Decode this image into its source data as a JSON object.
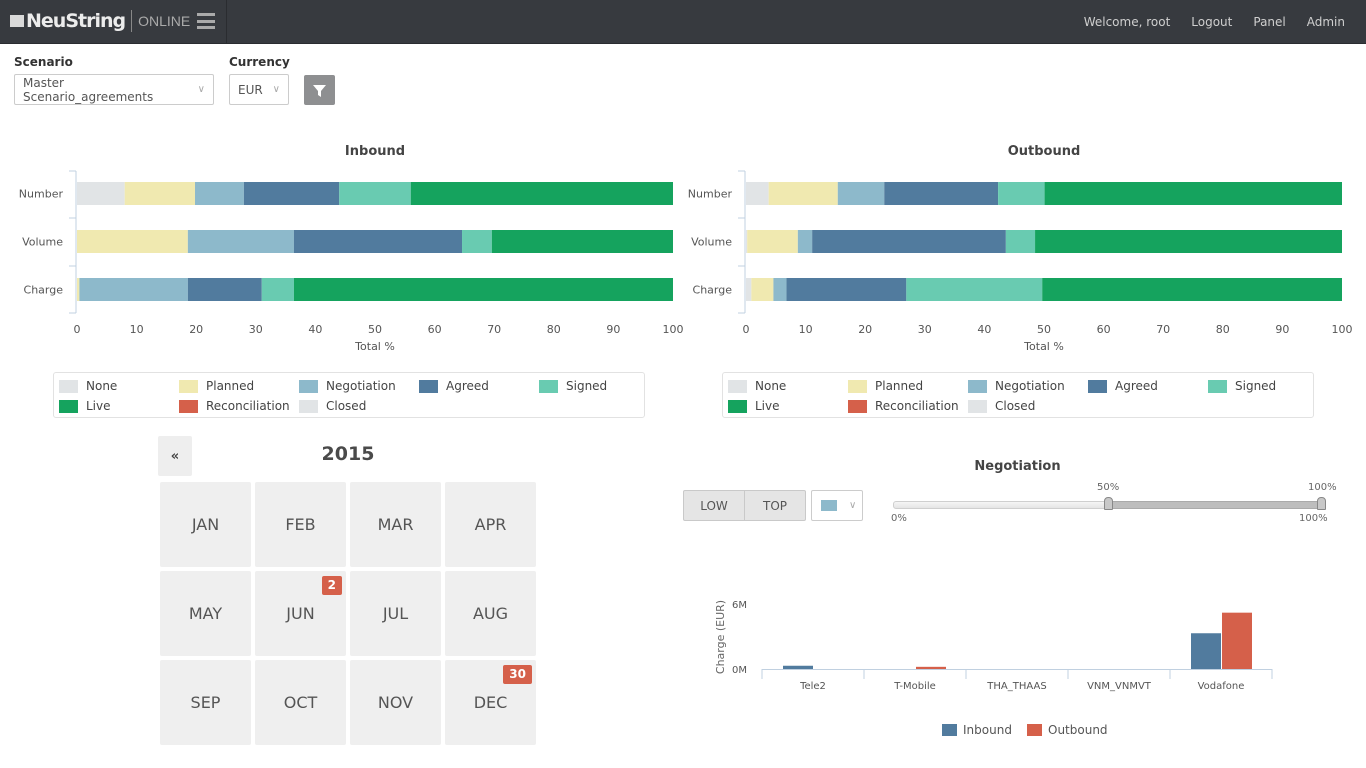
{
  "header": {
    "brand": "NeuString",
    "brand_sub": "ONLINE",
    "welcome": "Welcome, root",
    "nav": [
      "Logout",
      "Panel",
      "Admin"
    ]
  },
  "filters": {
    "scenario_label": "Scenario",
    "scenario_value": "Master Scenario_agreements",
    "currency_label": "Currency",
    "currency_value": "EUR",
    "filter_icon": "filter-icon"
  },
  "status_colors": {
    "None": "#e1e4e6",
    "Planned": "#f0e9b0",
    "Negotiation": "#8db9cb",
    "Agreed": "#517b9e",
    "Signed": "#69cbb1",
    "Live": "#15a35e",
    "Reconciliation": "#d5604a",
    "Closed": "#e1e4e6"
  },
  "legend": [
    "None",
    "Planned",
    "Negotiation",
    "Agreed",
    "Signed",
    "Live",
    "Reconciliation",
    "Closed"
  ],
  "chart_data": [
    {
      "type": "bar",
      "orientation": "horizontal-stacked",
      "title": "Inbound",
      "xlabel": "Total %",
      "ylabel": "",
      "xlim": [
        0,
        100
      ],
      "xticks": [
        0,
        10,
        20,
        30,
        40,
        50,
        60,
        70,
        80,
        90,
        100
      ],
      "categories": [
        "Number",
        "Volume",
        "Charge"
      ],
      "series": [
        {
          "name": "None",
          "values": [
            8,
            0,
            0
          ]
        },
        {
          "name": "Planned",
          "values": [
            11.8,
            18.6,
            0.4
          ]
        },
        {
          "name": "Negotiation",
          "values": [
            8.2,
            17.8,
            18.2
          ]
        },
        {
          "name": "Agreed",
          "values": [
            16,
            28.2,
            12.4
          ]
        },
        {
          "name": "Signed",
          "values": [
            12,
            5,
            5.4
          ]
        },
        {
          "name": "Live",
          "values": [
            44,
            30.4,
            63.6
          ]
        },
        {
          "name": "Reconciliation",
          "values": [
            0,
            0,
            0
          ]
        },
        {
          "name": "Closed",
          "values": [
            0,
            0,
            0
          ]
        }
      ],
      "legend_position": "bottom"
    },
    {
      "type": "bar",
      "orientation": "horizontal-stacked",
      "title": "Outbound",
      "xlabel": "Total %",
      "ylabel": "",
      "xlim": [
        0,
        100
      ],
      "xticks": [
        0,
        10,
        20,
        30,
        40,
        50,
        60,
        70,
        80,
        90,
        100
      ],
      "categories": [
        "Number",
        "Volume",
        "Charge"
      ],
      "series": [
        {
          "name": "None",
          "values": [
            3.8,
            0.2,
            0.9
          ]
        },
        {
          "name": "Planned",
          "values": [
            11.6,
            8.5,
            3.7
          ]
        },
        {
          "name": "Negotiation",
          "values": [
            7.8,
            2.4,
            2.2
          ]
        },
        {
          "name": "Agreed",
          "values": [
            19.1,
            32.5,
            20.1
          ]
        },
        {
          "name": "Signed",
          "values": [
            7.8,
            4.9,
            22.8
          ]
        },
        {
          "name": "Live",
          "values": [
            49.9,
            51.5,
            50.3
          ]
        },
        {
          "name": "Reconciliation",
          "values": [
            0,
            0,
            0
          ]
        },
        {
          "name": "Closed",
          "values": [
            0,
            0,
            0
          ]
        }
      ],
      "legend_position": "bottom"
    },
    {
      "type": "bar",
      "title": "",
      "xlabel": "",
      "ylabel": "Charge (EUR)",
      "ylim": [
        0,
        6
      ],
      "yticks": [
        "0M",
        "6M"
      ],
      "categories": [
        "Tele2",
        "T-Mobile",
        "THA_THAAS",
        "VNM_VNMVT",
        "Vodafone"
      ],
      "series": [
        {
          "name": "Inbound",
          "color": "#517b9e",
          "values": [
            0.3,
            0,
            0,
            0,
            3.3
          ]
        },
        {
          "name": "Outbound",
          "color": "#d5604a",
          "values": [
            0,
            0.2,
            0,
            0,
            5.2
          ]
        }
      ],
      "legend_position": "bottom"
    }
  ],
  "calendar": {
    "prev_label": "«",
    "year": "2015",
    "months": [
      {
        "label": "JAN",
        "badge": null
      },
      {
        "label": "FEB",
        "badge": null
      },
      {
        "label": "MAR",
        "badge": null
      },
      {
        "label": "APR",
        "badge": null
      },
      {
        "label": "MAY",
        "badge": null
      },
      {
        "label": "JUN",
        "badge": "2"
      },
      {
        "label": "JUL",
        "badge": null
      },
      {
        "label": "AUG",
        "badge": null
      },
      {
        "label": "SEP",
        "badge": null
      },
      {
        "label": "OCT",
        "badge": null
      },
      {
        "label": "NOV",
        "badge": null
      },
      {
        "label": "DEC",
        "badge": "30"
      }
    ]
  },
  "negotiation": {
    "title": "Negotiation",
    "low_label": "LOW",
    "top_label": "TOP",
    "selected_color": "#8db9cb",
    "slider": {
      "min_label": "0%",
      "max_label": "100%",
      "low_value_label": "50%",
      "high_value_label": "100%",
      "low_value": 50,
      "high_value": 100
    }
  }
}
